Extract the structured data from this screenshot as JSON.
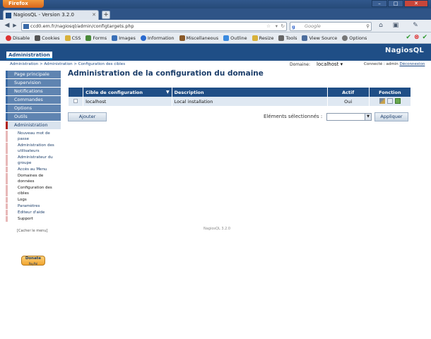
{
  "browser": {
    "menu_button": "Firefox",
    "tab_title": "NagiosQL - Version 3.2.0",
    "new_tab": "+",
    "url": "ccd0.em.fr/nagiosql/admin/configtargets.php",
    "search_engine": "Google",
    "search_placeholder": "Google",
    "nav_back": "◀",
    "nav_forward": "▶",
    "reload": "↻",
    "home": "⌂",
    "toolbar_items": [
      "Disable",
      "Cookies",
      "CSS",
      "Forms",
      "Images",
      "Information",
      "Miscellaneous",
      "Outline",
      "Resize",
      "Tools",
      "View Source",
      "Options"
    ]
  },
  "app": {
    "top_tab": "Administration",
    "logo": "NagiosQL",
    "breadcrumb": "Administration > Administration > Configuration des cibles",
    "domain_label": "Domaine:",
    "domain_value": "localhost",
    "connected_text": "Connecté : admin",
    "logout_link": "Déconnexion"
  },
  "sidebar": {
    "main_items": [
      {
        "label": "Page principale"
      },
      {
        "label": "Supervision"
      },
      {
        "label": "Notifications"
      },
      {
        "label": "Commandes"
      },
      {
        "label": "Options"
      },
      {
        "label": "Outils"
      },
      {
        "label": "Administration"
      }
    ],
    "sub_items": [
      "Nouveau mot de passe",
      "Administration des utilisateurs",
      "Administrateur du groupe",
      "Accès au Menu",
      "Domaines de données",
      "Configuration des cibles",
      "Logs",
      "Paramètres",
      "Editeur d'aide",
      "Support"
    ],
    "hide_menu": "[Cacher le menu]",
    "donate_label": "Donate",
    "donate_sub": "PayPal"
  },
  "main": {
    "title": "Administration de la configuration du domaine",
    "columns": [
      "Cible de configuration",
      "Description",
      "Actif",
      "Fonction"
    ],
    "rows": [
      {
        "target": "localhost",
        "description": "Local installation",
        "active": "Oui"
      }
    ],
    "add_button": "Ajouter",
    "selected_label": "Eléments sélectionnés :",
    "apply_button": "Appliquer",
    "footer": "NagiosQL 3.2.0"
  }
}
